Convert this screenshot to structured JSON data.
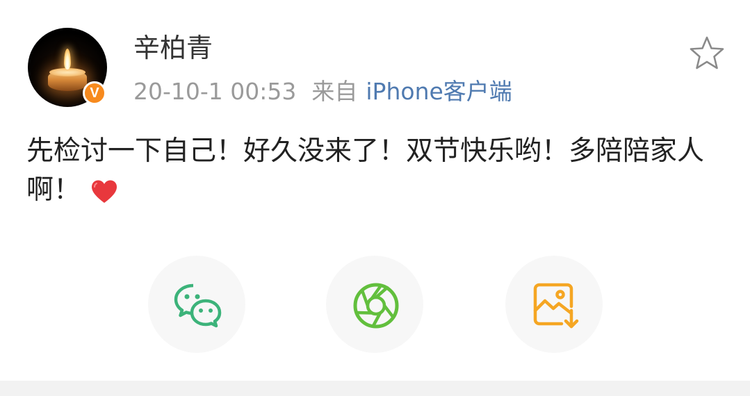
{
  "post": {
    "author": {
      "name": "辛柏青",
      "verified_badge": "V",
      "avatar_icon": "candle-avatar"
    },
    "meta": {
      "time": "20-10-1 00:53",
      "from_label": "来自",
      "source": "iPhone客户端"
    },
    "content": {
      "text": "先检讨一下自己！好久没来了！双节快乐哟！多陪陪家人啊！",
      "emoji": "heart-icon"
    },
    "actions": {
      "favorite_icon": "star-icon"
    }
  },
  "share": {
    "items": [
      {
        "icon": "wechat-icon",
        "color": "#3cb37a"
      },
      {
        "icon": "moments-icon",
        "color": "#62bf3d"
      },
      {
        "icon": "save-image-icon",
        "color": "#f5a623"
      }
    ]
  },
  "colors": {
    "text_primary": "#222222",
    "text_meta": "#9a9a9a",
    "link_blue": "#4f7ab0",
    "badge_orange": "#f78a1e",
    "heart_red": "#e8383d"
  }
}
